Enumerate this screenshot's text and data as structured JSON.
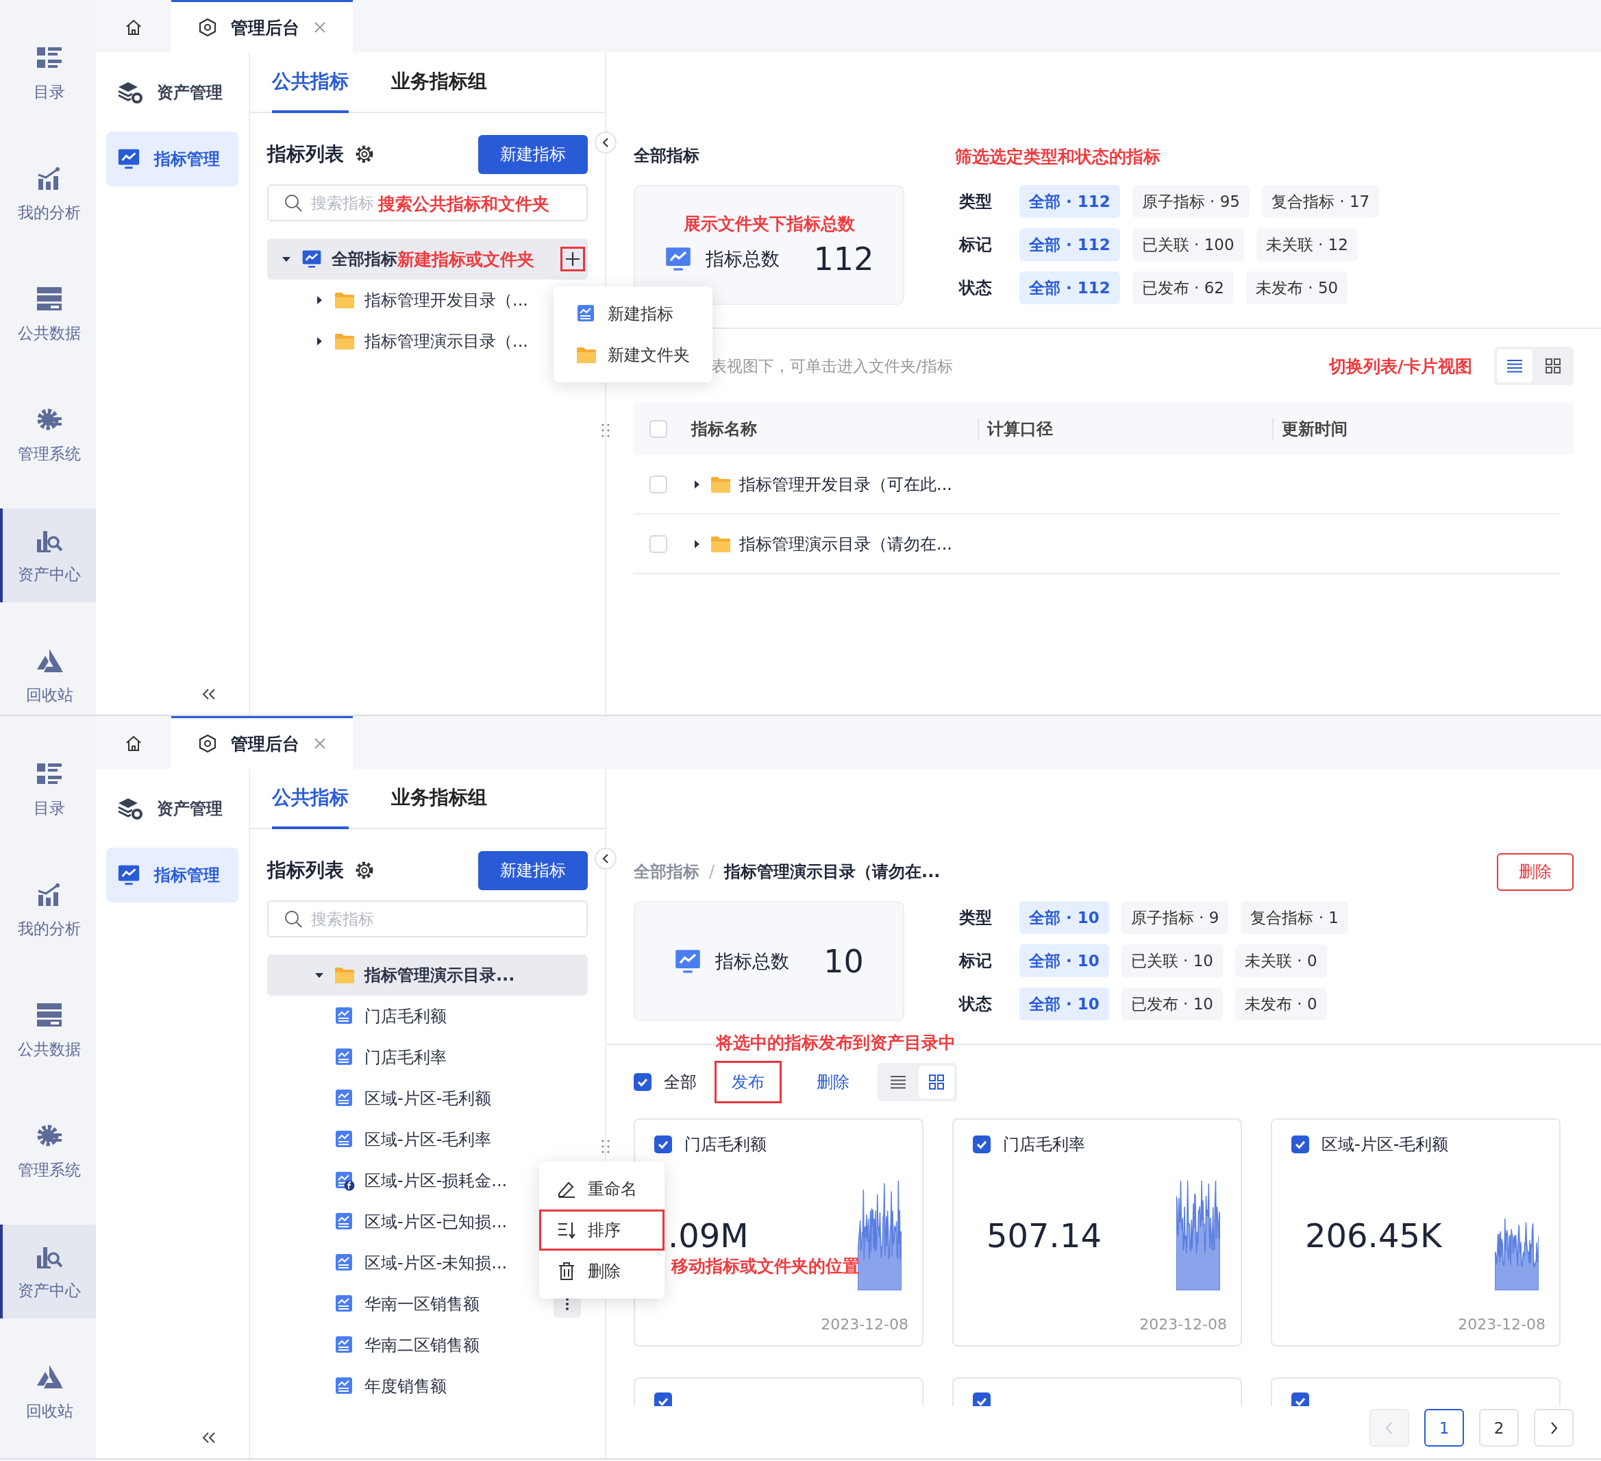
{
  "screens": [
    {
      "nav_rail": [
        {
          "label": "目录",
          "selected": false
        },
        {
          "label": "我的分析",
          "selected": false
        },
        {
          "label": "公共数据",
          "selected": false
        },
        {
          "label": "管理系统",
          "selected": false
        },
        {
          "label": "资产中心",
          "selected": true
        },
        {
          "label": "回收站",
          "selected": false
        }
      ],
      "tabs": [
        {
          "kind": "home",
          "selected": false
        },
        {
          "kind": "page",
          "label": "管理后台",
          "selected": true
        }
      ],
      "side_menu": [
        {
          "label": "资产管理",
          "selected": false
        },
        {
          "label": "指标管理",
          "selected": true
        }
      ],
      "panel_tabs": [
        {
          "label": "公共指标",
          "selected": true
        },
        {
          "label": "业务指标组",
          "selected": false
        }
      ],
      "list_title": "指标列表",
      "new_button": "新建指标",
      "search": {
        "placeholder": "搜索指标",
        "annotation": "搜索公共指标和文件夹"
      },
      "tree": [
        {
          "kind": "all",
          "label": "全部指标",
          "annotation": "新建指标或文件夹",
          "expanded": true,
          "selected": true,
          "add_highlighted": true,
          "children": [
            {
              "kind": "folder",
              "label": "指标管理开发目录（...",
              "expanded": false,
              "selected": false
            },
            {
              "kind": "folder",
              "label": "指标管理演示目录（...",
              "expanded": false,
              "selected": false
            }
          ]
        }
      ],
      "popup_menu": {
        "items": [
          {
            "kind": "new-metric",
            "label": "新建指标",
            "highlighted": false
          },
          {
            "kind": "new-folder",
            "label": "新建文件夹",
            "highlighted": false
          }
        ]
      },
      "main": {
        "breadcrumb": [
          "全部指标"
        ],
        "stat": {
          "annotation": "展示文件夹下指标总数",
          "label": "指标总数",
          "value": "112"
        },
        "filters_annotation": "筛选选定类型和状态的指标",
        "filters": [
          {
            "label": "类型",
            "chips": [
              {
                "label": "全部 · 112",
                "selected": true
              },
              {
                "label": "原子指标 · 95",
                "selected": false
              },
              {
                "label": "复合指标 · 17",
                "selected": false
              }
            ]
          },
          {
            "label": "标记",
            "chips": [
              {
                "label": "全部 · 112",
                "selected": true
              },
              {
                "label": "已关联 · 100",
                "selected": false
              },
              {
                "label": "未关联 · 12",
                "selected": false
              }
            ]
          },
          {
            "label": "状态",
            "chips": [
              {
                "label": "全部 · 112",
                "selected": true
              },
              {
                "label": "已发布 · 62",
                "selected": false
              },
              {
                "label": "未发布 · 50",
                "selected": false
              }
            ]
          }
        ],
        "toolbar": {
          "hint": "表视图下，可单击进入文件夹/指标",
          "annotation": "切换列表/卡片视图",
          "views": [
            {
              "kind": "list",
              "selected": true
            },
            {
              "kind": "grid",
              "selected": false
            }
          ]
        },
        "table": {
          "select_all_checked": false,
          "columns": [
            "指标名称",
            "计算口径",
            "更新时间"
          ],
          "rows": [
            {
              "name": "指标管理开发目录（可在此...",
              "checked": false,
              "expanded": false
            },
            {
              "name": "指标管理演示目录（请勿在...",
              "checked": false,
              "expanded": false
            }
          ]
        }
      }
    },
    {
      "nav_rail": [
        {
          "label": "目录",
          "selected": false
        },
        {
          "label": "我的分析",
          "selected": false
        },
        {
          "label": "公共数据",
          "selected": false
        },
        {
          "label": "管理系统",
          "selected": false
        },
        {
          "label": "资产中心",
          "selected": true
        },
        {
          "label": "回收站",
          "selected": false
        }
      ],
      "tabs": [
        {
          "kind": "home",
          "selected": false
        },
        {
          "kind": "page",
          "label": "管理后台",
          "selected": true
        }
      ],
      "side_menu": [
        {
          "label": "资产管理",
          "selected": false
        },
        {
          "label": "指标管理",
          "selected": true
        }
      ],
      "panel_tabs": [
        {
          "label": "公共指标",
          "selected": true
        },
        {
          "label": "业务指标组",
          "selected": false
        }
      ],
      "list_title": "指标列表",
      "new_button": "新建指标",
      "search": {
        "placeholder": "搜索指标"
      },
      "tree": [
        {
          "kind": "folder",
          "label": "指标管理演示目录...",
          "expanded": true,
          "selected": true,
          "children": [
            {
              "kind": "metric",
              "label": "门店毛利额",
              "actions_shown": false
            },
            {
              "kind": "metric",
              "label": "门店毛利率",
              "actions_shown": false
            },
            {
              "kind": "metric",
              "label": "区域-片区-毛利额",
              "actions_shown": false
            },
            {
              "kind": "metric",
              "label": "区域-片区-毛利率",
              "actions_shown": false
            },
            {
              "kind": "composite",
              "label": "区域-片区-损耗金...",
              "actions_shown": false
            },
            {
              "kind": "metric",
              "label": "区域-片区-已知损...",
              "actions_shown": false
            },
            {
              "kind": "metric",
              "label": "区域-片区-未知损...",
              "actions_shown": false
            },
            {
              "kind": "metric",
              "label": "华南一区销售额",
              "actions_shown": true
            },
            {
              "kind": "metric",
              "label": "华南二区销售额",
              "actions_shown": false
            },
            {
              "kind": "metric",
              "label": "年度销售额",
              "actions_shown": false
            }
          ]
        }
      ],
      "popup_menu": {
        "annotation": "移动指标或文件夹的位置",
        "items": [
          {
            "kind": "rename",
            "label": "重命名",
            "highlighted": false
          },
          {
            "kind": "sort",
            "label": "排序",
            "highlighted": true
          },
          {
            "kind": "delete",
            "label": "删除",
            "highlighted": false
          }
        ]
      },
      "main": {
        "breadcrumb": [
          "全部指标",
          "指标管理演示目录（请勿在..."
        ],
        "breadcrumb_separator": "/",
        "delete_button": "删除",
        "stat": {
          "label": "指标总数",
          "value": "10"
        },
        "filters": [
          {
            "label": "类型",
            "chips": [
              {
                "label": "全部 · 10",
                "selected": true
              },
              {
                "label": "原子指标 · 9",
                "selected": false
              },
              {
                "label": "复合指标 · 1",
                "selected": false
              }
            ]
          },
          {
            "label": "标记",
            "chips": [
              {
                "label": "全部 · 10",
                "selected": true
              },
              {
                "label": "已关联 · 10",
                "selected": false
              },
              {
                "label": "未关联 · 0",
                "selected": false
              }
            ]
          },
          {
            "label": "状态",
            "chips": [
              {
                "label": "全部 · 10",
                "selected": true
              },
              {
                "label": "已发布 · 10",
                "selected": false
              },
              {
                "label": "未发布 · 0",
                "selected": false
              }
            ]
          }
        ],
        "toolbar": {
          "annotation": "将选中的指标发布到资产目录中",
          "select_all": {
            "label": "全部",
            "checked": true
          },
          "actions": [
            {
              "label": "发布",
              "highlighted": true
            },
            {
              "label": "删除",
              "highlighted": false
            }
          ],
          "views": [
            {
              "kind": "list",
              "selected": false
            },
            {
              "kind": "grid",
              "selected": true
            }
          ]
        },
        "cards": [
          {
            "title": "门店毛利额",
            "value": ".09M",
            "date": "2023-12-08",
            "checked": true
          },
          {
            "title": "门店毛利率",
            "value": "507.14",
            "date": "2023-12-08",
            "checked": true
          },
          {
            "title": "区域-片区-毛利额",
            "value": "206.45K",
            "date": "2023-12-08",
            "checked": true
          },
          {
            "checked": true
          },
          {
            "checked": true
          },
          {
            "checked": true
          }
        ],
        "pagination": [
          {
            "kind": "prev",
            "disabled": true
          },
          {
            "kind": "page",
            "label": "1",
            "selected": true
          },
          {
            "kind": "page",
            "label": "2",
            "selected": false
          },
          {
            "kind": "next",
            "disabled": false
          }
        ]
      }
    }
  ]
}
